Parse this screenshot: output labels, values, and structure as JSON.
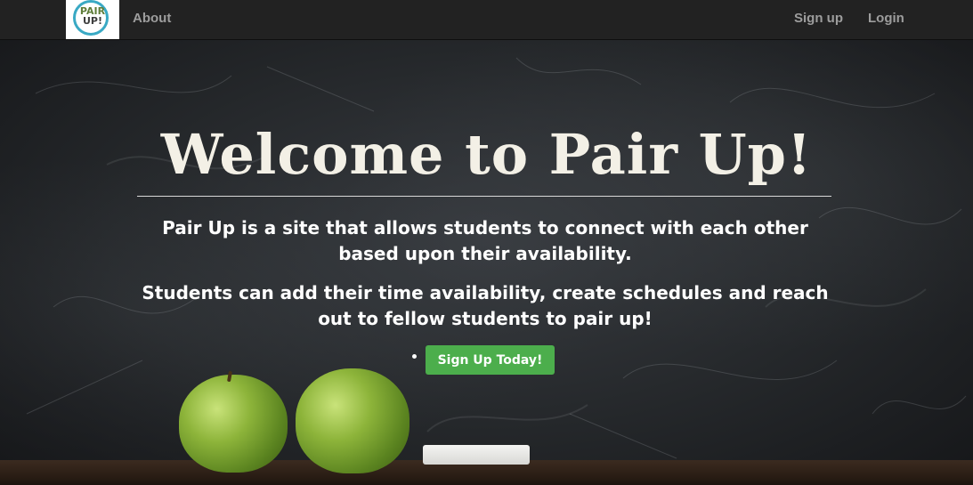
{
  "nav": {
    "logo_line1": "PAIR",
    "logo_line2": "UP!",
    "about_label": "About",
    "signup_label": "Sign up",
    "login_label": "Login"
  },
  "hero": {
    "title": "Welcome to Pair Up!",
    "paragraph1": "Pair Up is a site that allows students to connect with each other based upon their availability.",
    "paragraph2": "Students can add their time availability, create schedules and reach out to fellow students to pair up!",
    "cta_label": "Sign Up Today!"
  },
  "colors": {
    "navbar_bg": "#222222",
    "nav_link": "#9d9d9d",
    "cta_bg": "#4cae4c",
    "chalkboard": "#26292c",
    "logo_ring": "#39a9c4"
  }
}
